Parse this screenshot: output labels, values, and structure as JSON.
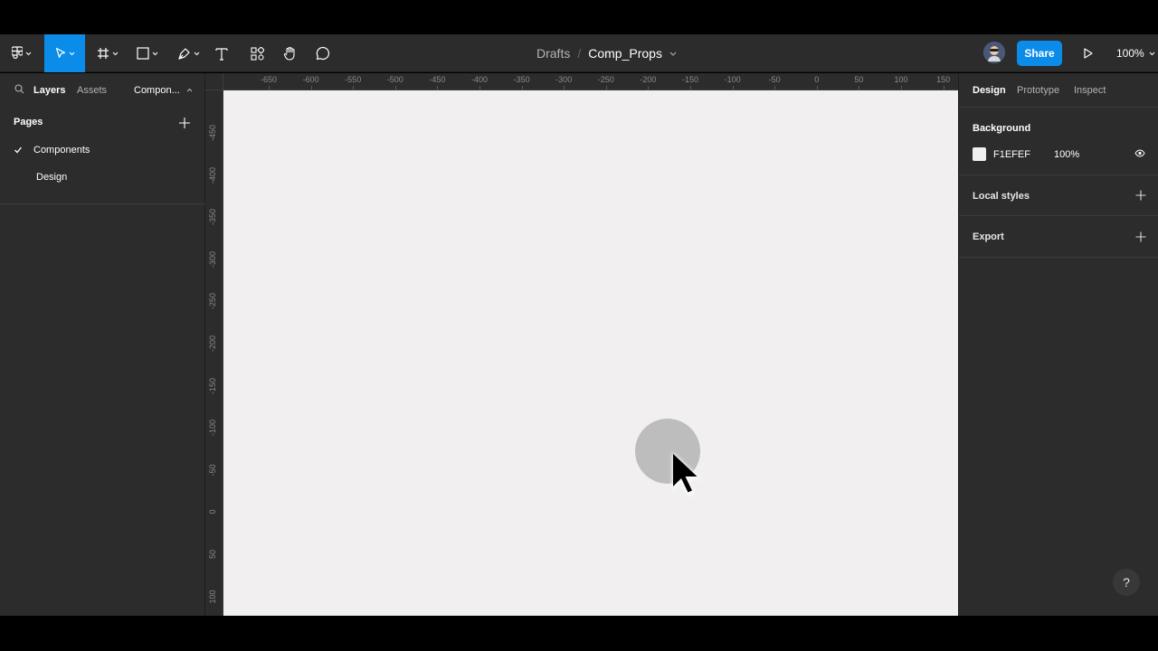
{
  "toolbar": {
    "tools": [
      {
        "name": "main-menu",
        "icon": "figma-logo-icon"
      },
      {
        "name": "move",
        "icon": "move-pointer-icon",
        "active": true
      },
      {
        "name": "frame",
        "icon": "frame-hash-icon"
      },
      {
        "name": "shape",
        "icon": "rectangle-icon"
      },
      {
        "name": "pen",
        "icon": "pen-icon"
      },
      {
        "name": "text",
        "icon": "text-t-icon"
      },
      {
        "name": "resources",
        "icon": "resources-icon"
      },
      {
        "name": "hand",
        "icon": "hand-icon"
      },
      {
        "name": "comment",
        "icon": "comment-bubble-icon"
      }
    ],
    "breadcrumb": {
      "folder": "Drafts",
      "separator": "/",
      "file": "Comp_Props"
    },
    "share_label": "Share",
    "zoom_label": "100%",
    "accent": "#0c8ce9"
  },
  "left_panel": {
    "tabs": {
      "layers": "Layers",
      "assets": "Assets",
      "page_selector": "Compon..."
    },
    "pages_title": "Pages",
    "pages": [
      {
        "label": "Components",
        "current": true
      },
      {
        "label": "Design",
        "current": false
      }
    ]
  },
  "rulers": {
    "horizontal": [
      "-650",
      "-600",
      "-550",
      "-500",
      "-450",
      "-400",
      "-350",
      "-300",
      "-250",
      "-200",
      "-150",
      "-100",
      "-50",
      "0",
      "50",
      "100",
      "150"
    ],
    "vertical": [
      "-450",
      "-400",
      "-350",
      "-300",
      "-250",
      "-200",
      "-150",
      "-100",
      "-50",
      "0",
      "50",
      "100"
    ]
  },
  "canvas": {
    "background": "#f1efef"
  },
  "right_panel": {
    "tabs": {
      "design": "Design",
      "prototype": "Prototype",
      "inspect": "Inspect"
    },
    "background": {
      "title": "Background",
      "hex": "F1EFEF",
      "opacity": "100%",
      "color": "#f1efef"
    },
    "local_styles": "Local styles",
    "export": "Export",
    "help": "?"
  }
}
